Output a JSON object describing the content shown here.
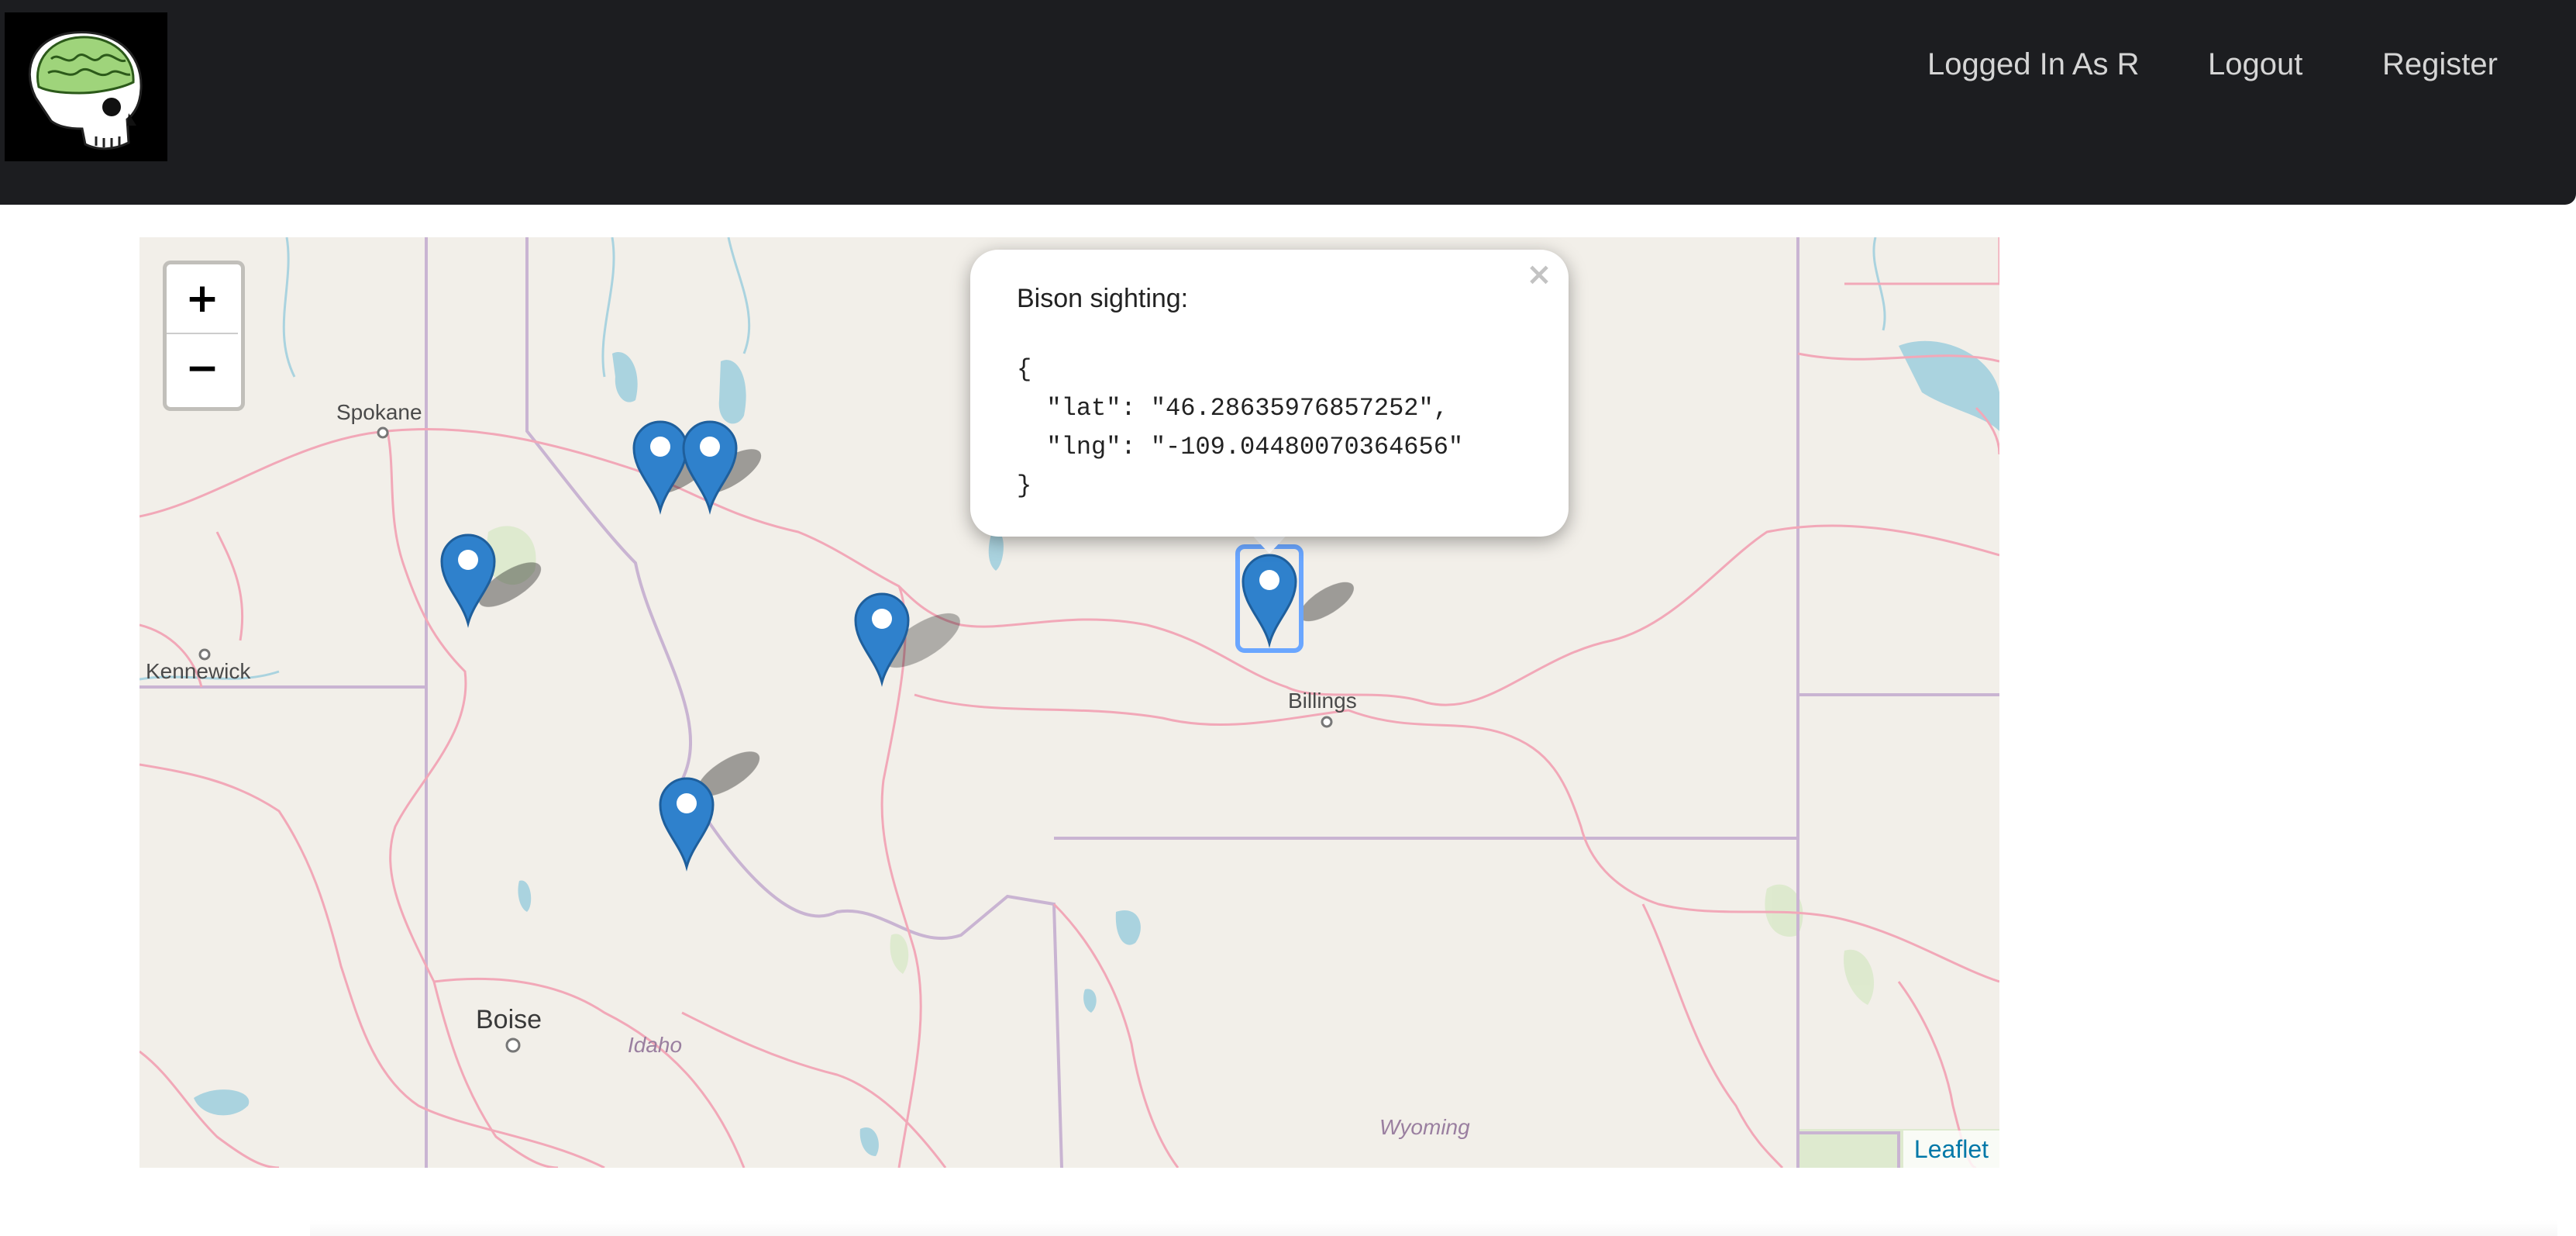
{
  "header": {
    "logo_label": "",
    "nav": [
      "Logged In As R",
      "Logout",
      "Register"
    ]
  },
  "map": {
    "zoom_in": "+",
    "zoom_out": "−",
    "attribution": "Leaflet",
    "places": {
      "spokane": "Spokane",
      "kennewick": "Kennewick",
      "billings": "Billings",
      "boise": "Boise",
      "idaho": "Idaho",
      "wyoming": "Wyoming"
    },
    "marker_icon": "map-pin-icon",
    "marker_color": "#2f81cc",
    "markers_count": 6
  },
  "popup": {
    "title": "Bison sighting:",
    "code": "{\n  \"lat\": \"46.28635976857252\",\n  \"lng\": \"-109.04480070364656\"\n}",
    "close": "×"
  }
}
